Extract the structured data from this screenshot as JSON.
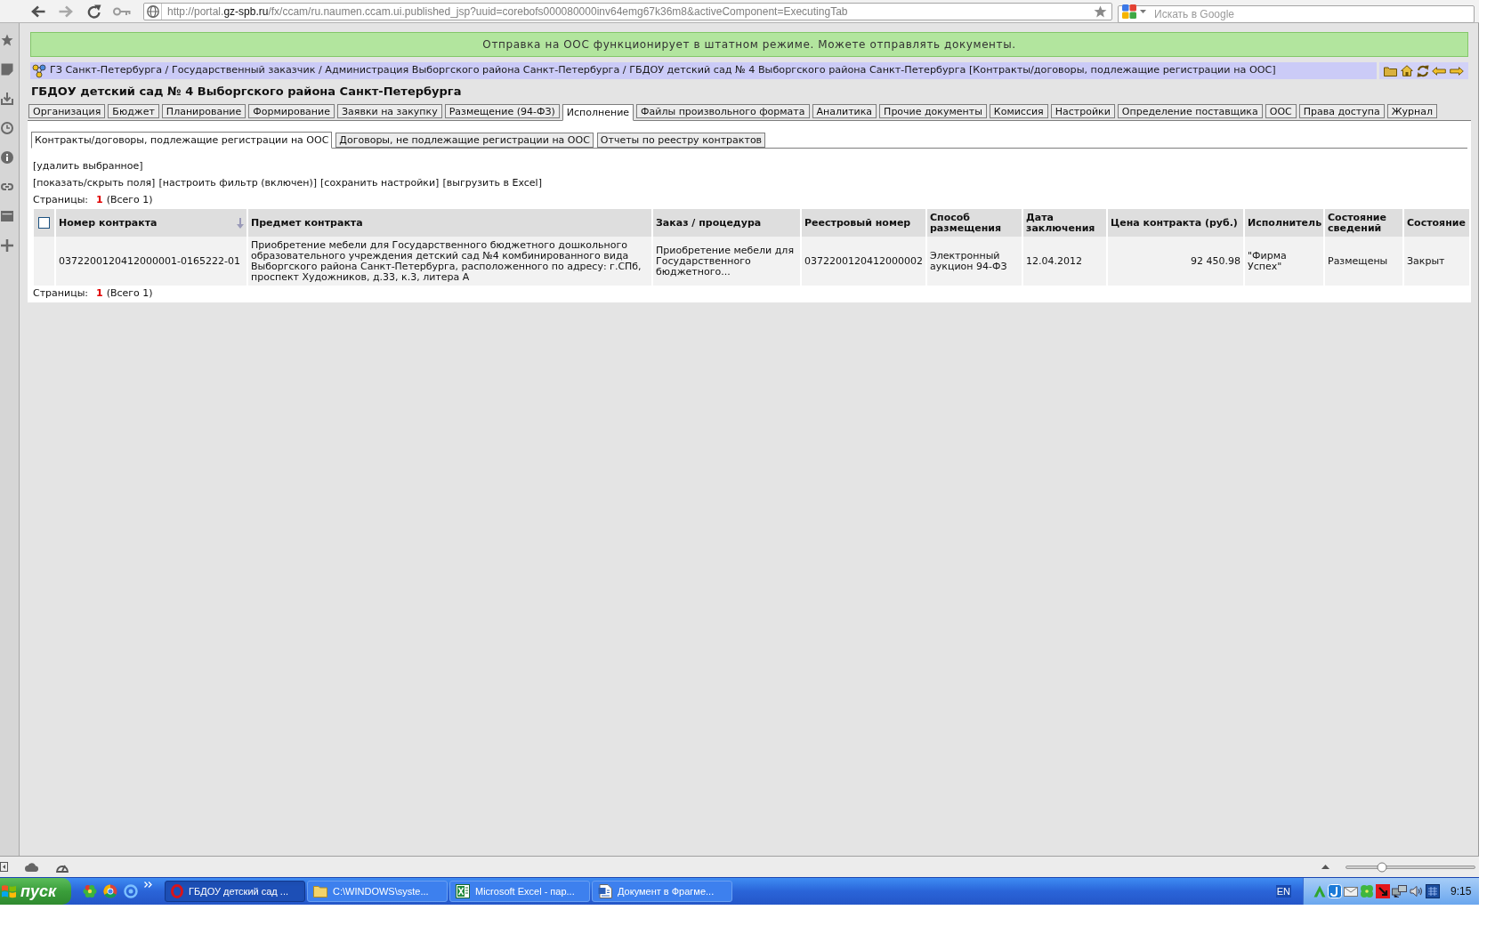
{
  "browser": {
    "back": {
      "disabled": false
    },
    "forward": {
      "disabled": true
    },
    "address_parts": [
      {
        "text": "http://portal.",
        "strong": false
      },
      {
        "text": "gz-spb.ru",
        "strong": true
      },
      {
        "text": "/fx/ccam/ru.naumen.ccam.ui.published_jsp?uuid=corebofs000080000inv64emg67k36m8&activeComponent=ExecutingTab",
        "strong": false
      }
    ],
    "search_placeholder": "Искать в Google"
  },
  "banner": {
    "text": "Отправка на ООС функционирует в штатном режиме. Можете отправлять документы."
  },
  "breadcrumb": {
    "text": "ГЗ Санкт-Петербурга / Государственный заказчик / Администрация Выборгского района Санкт-Петербурга / ГБДОУ детский сад № 4 Выборгского района Санкт-Петербурга [Контракты/договоры, подлежащие регистрации на ООС]"
  },
  "title": "ГБДОУ детский сад № 4 Выборгского района Санкт-Петербурга",
  "tabs": [
    {
      "label": "Организация",
      "selected": false
    },
    {
      "label": "Бюджет",
      "selected": false
    },
    {
      "label": "Планирование",
      "selected": false
    },
    {
      "label": "Формирование",
      "selected": false
    },
    {
      "label": "Заявки на закупку",
      "selected": false
    },
    {
      "label": "Размещение (94-ФЗ)",
      "selected": false
    },
    {
      "label": "Исполнение",
      "selected": true
    },
    {
      "label": "Файлы произвольного формата",
      "selected": false
    },
    {
      "label": "Аналитика",
      "selected": false
    },
    {
      "label": "Прочие документы",
      "selected": false
    },
    {
      "label": "Комиссия",
      "selected": false
    },
    {
      "label": "Настройки",
      "selected": false
    },
    {
      "label": "Определение поставщика",
      "selected": false
    },
    {
      "label": "ООС",
      "selected": false
    },
    {
      "label": "Права доступа",
      "selected": false
    },
    {
      "label": "Журнал",
      "selected": false
    }
  ],
  "subtabs": [
    {
      "label": "Контракты/договоры, подлежащие регистрации на ООС",
      "selected": true
    },
    {
      "label": "Договоры, не подлежащие регистрации на ООС",
      "selected": false
    },
    {
      "label": "Отчеты по реестру контрактов",
      "selected": false
    }
  ],
  "action_rows": [
    [
      {
        "label": "[удалить выбранное]"
      }
    ],
    [
      {
        "label": "[показать/скрыть поля]"
      },
      {
        "label": "[настроить фильтр (включен)]"
      },
      {
        "label": "[сохранить настройки]"
      },
      {
        "label": "[выгрузить в Excel]"
      }
    ]
  ],
  "pager_top": {
    "label": "Страницы:",
    "current": "1",
    "total": "(Всего 1)"
  },
  "table": {
    "header_checkbox": {
      "checked": false
    },
    "columns": [
      {
        "label": "Номер контракта",
        "sorted": true,
        "kind": "text"
      },
      {
        "label": "Предмет контракта",
        "sorted": false,
        "kind": "text"
      },
      {
        "label": "Заказ / процедура",
        "sorted": false,
        "kind": "text"
      },
      {
        "label": "Реестровый номер",
        "sorted": false,
        "kind": "text"
      },
      {
        "label": "Способ размещения",
        "sorted": false,
        "kind": "text"
      },
      {
        "label": "Дата заключения",
        "sorted": false,
        "kind": "text"
      },
      {
        "label": "Цена контракта (руб.)",
        "sorted": false,
        "kind": "number"
      },
      {
        "label": "Исполнитель",
        "sorted": false,
        "kind": "text"
      },
      {
        "label": "Состояние сведений",
        "sorted": false,
        "kind": "text"
      },
      {
        "label": "Состояние",
        "sorted": false,
        "kind": "text"
      }
    ],
    "rows": [
      {
        "cells": [
          "0372200120412000001-0165222-01",
          "Приобретение мебели для Государственного бюджетного дошкольного образовательного учреждения детский сад №4 комбинированного вида Выборгского района Санкт-Петербурга, расположенного по адресу: г.СПб, проспект Художников, д.33, к.3, литера А",
          "Приобретение мебели для Государственного бюджетного...",
          "0372200120412000002",
          "Электронный аукцион 94-ФЗ",
          "12.04.2012",
          "92 450.98",
          "\"Фирма Успех\"",
          "Размещены",
          "Закрыт"
        ]
      }
    ]
  },
  "pager_bottom": {
    "label": "Страницы:",
    "current": "1",
    "total": "(Всего 1)"
  },
  "status_bar": {
    "zoom": {
      "level": 0.28
    }
  },
  "taskbar": {
    "start_label": "пуск",
    "tasks": [
      {
        "label": "ГБДОУ детский сад ...",
        "selected": true
      },
      {
        "label": "C:\\WINDOWS\\syste...",
        "selected": false
      },
      {
        "label": "Microsoft Excel - пар...",
        "selected": false
      },
      {
        "label": "Документ в Фрагме...",
        "selected": false
      }
    ],
    "language": "EN",
    "clock": "9:15"
  }
}
